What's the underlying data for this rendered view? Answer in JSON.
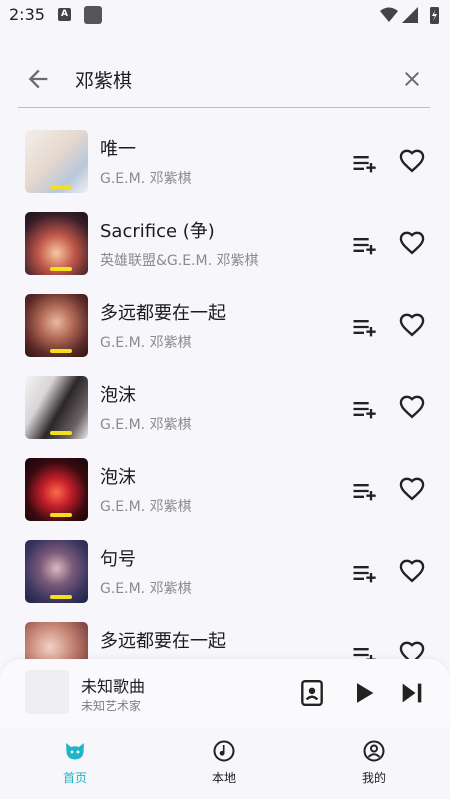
{
  "status": {
    "time": "2:35",
    "notification_icon": "A"
  },
  "search": {
    "query": "邓紫棋"
  },
  "songs": [
    {
      "title": "唯一",
      "artist": "G.E.M. 邓紫棋"
    },
    {
      "title": "Sacrifice (争)",
      "artist": "英雄联盟&G.E.M. 邓紫棋"
    },
    {
      "title": "多远都要在一起",
      "artist": "G.E.M. 邓紫棋"
    },
    {
      "title": "泡沫",
      "artist": "G.E.M. 邓紫棋"
    },
    {
      "title": "泡沫",
      "artist": "G.E.M. 邓紫棋"
    },
    {
      "title": "句号",
      "artist": "G.E.M. 邓紫棋"
    },
    {
      "title": "多远都要在一起",
      "artist": ""
    }
  ],
  "player": {
    "title": "未知歌曲",
    "artist": "未知艺术家"
  },
  "nav": {
    "items": [
      {
        "label": "首页"
      },
      {
        "label": "本地"
      },
      {
        "label": "我的"
      }
    ]
  },
  "colors": {
    "accent": "#1fb4c8",
    "cover_tag": "#f2df1d"
  },
  "icons": [
    "back-arrow",
    "close",
    "playlist-add",
    "heart-outline",
    "queue",
    "play",
    "skip-next",
    "cat-home",
    "music-note",
    "account-circle"
  ]
}
